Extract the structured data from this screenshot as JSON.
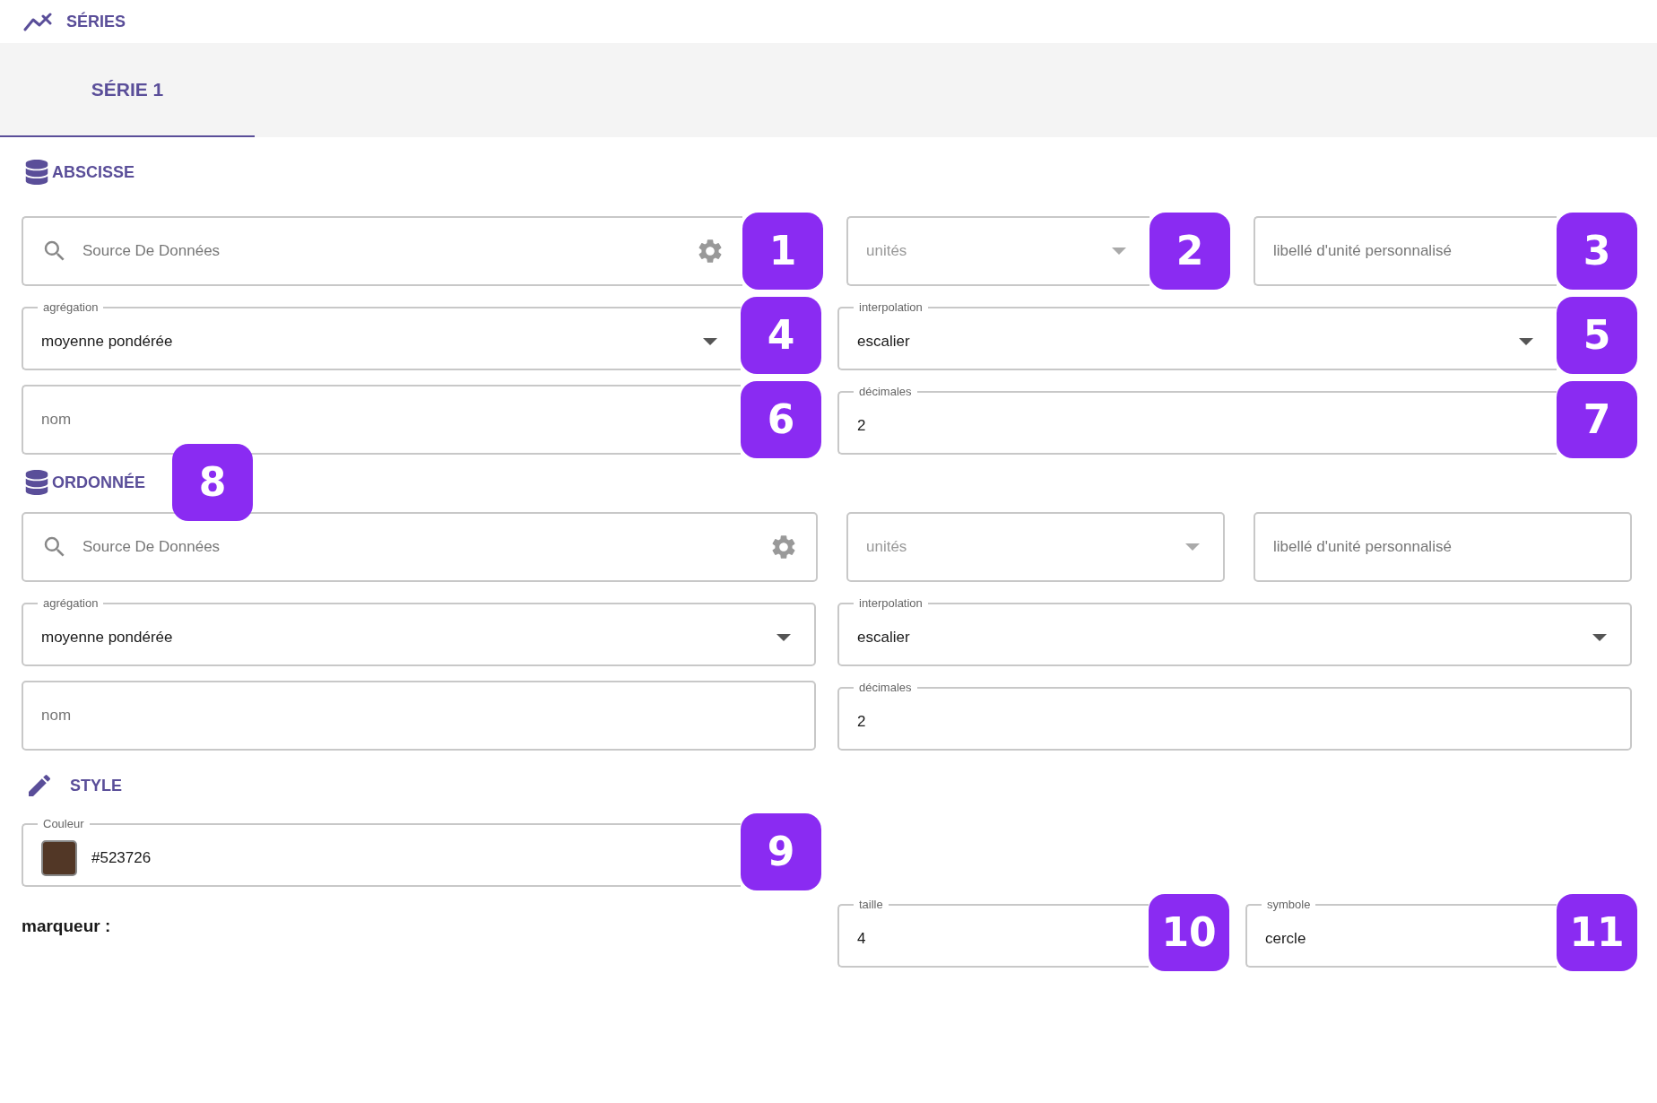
{
  "header": {
    "title": "SÉRIES"
  },
  "tabs": [
    {
      "label": "SÉRIE 1",
      "selected": true
    }
  ],
  "sections": [
    {
      "title": "ABSCISSE",
      "rows": [
        [
          {
            "kind": "search",
            "placeholder": "Source De Données",
            "badge": "1"
          },
          {
            "kind": "select",
            "placeholder": "unités",
            "badge": "2"
          },
          {
            "kind": "text",
            "placeholder": "libellé d'unité personnalisé",
            "badge": "3"
          }
        ],
        [
          {
            "kind": "select",
            "label": "agrégation",
            "value": "moyenne pondérée",
            "badge": "4"
          },
          {
            "kind": "select",
            "label": "interpolation",
            "value": "escalier",
            "badge": "5"
          }
        ],
        [
          {
            "kind": "text",
            "placeholder": "nom",
            "badge": "6"
          },
          {
            "kind": "text",
            "label": "décimales",
            "value": "2",
            "badge": "7"
          }
        ]
      ]
    },
    {
      "title": "ORDONNÉE",
      "badge": "8",
      "rows": [
        [
          {
            "kind": "search",
            "placeholder": "Source De Données"
          },
          {
            "kind": "select",
            "placeholder": "unités"
          },
          {
            "kind": "text",
            "placeholder": "libellé d'unité personnalisé"
          }
        ],
        [
          {
            "kind": "select",
            "label": "agrégation",
            "value": "moyenne pondérée"
          },
          {
            "kind": "select",
            "label": "interpolation",
            "value": "escalier"
          }
        ],
        [
          {
            "kind": "text",
            "placeholder": "nom"
          },
          {
            "kind": "text",
            "label": "décimales",
            "value": "2"
          }
        ]
      ]
    }
  ],
  "style": {
    "title": "STYLE",
    "color_field": {
      "kind": "color",
      "label": "Couleur",
      "value": "#523726",
      "badge": "9"
    },
    "marker": {
      "label": "marqueur :",
      "fields": [
        {
          "kind": "text",
          "label": "taille",
          "value": "4",
          "badge": "10"
        },
        {
          "kind": "text",
          "label": "symbole",
          "value": "cercle",
          "badge": "11"
        }
      ]
    }
  }
}
